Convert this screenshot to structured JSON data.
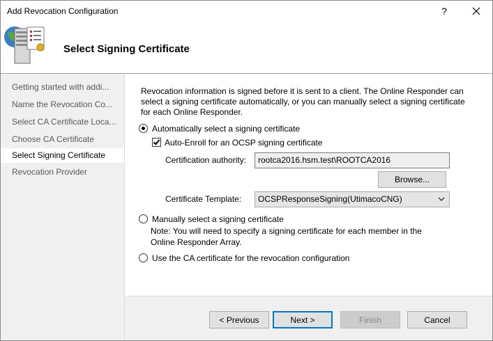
{
  "window": {
    "title": "Add Revocation Configuration",
    "help_label": "?",
    "close_label": "✕"
  },
  "header": {
    "title": "Select Signing Certificate",
    "icon": "certificate-server-icon"
  },
  "sidebar": {
    "items": [
      {
        "label": "Getting started with addi...",
        "active": false
      },
      {
        "label": "Name the Revocation Co...",
        "active": false
      },
      {
        "label": "Select CA Certificate Loca...",
        "active": false
      },
      {
        "label": "Choose CA Certificate",
        "active": false
      },
      {
        "label": "Select Signing Certificate",
        "active": true
      },
      {
        "label": "Revocation Provider",
        "active": false
      }
    ]
  },
  "main": {
    "description": "Revocation information is signed before it is sent to a client. The Online Responder can select a signing certificate automatically, or you can manually select a signing certificate for each Online Responder.",
    "option_auto": {
      "label": "Automatically select a signing certificate",
      "selected": true
    },
    "auto_enroll": {
      "label": "Auto-Enroll for an OCSP signing certificate",
      "checked": true
    },
    "ca_label": "Certification authority:",
    "ca_value": "rootca2016.hsm.test\\ROOTCA2016",
    "browse_label": "Browse...",
    "template_label": "Certificate Template:",
    "template_value": "OCSPResponseSigning(UtimacoCNG)",
    "option_manual": {
      "label": "Manually select a signing certificate",
      "selected": false
    },
    "manual_note": "Note: You will need to specify a signing certificate for each member in the Online Responder Array.",
    "option_ca_cert": {
      "label": "Use the CA certificate for the revocation configuration",
      "selected": false
    }
  },
  "footer": {
    "previous_label": "< Previous",
    "next_label": "Next >",
    "finish_label": "Finish",
    "cancel_label": "Cancel"
  },
  "colors": {
    "accent": "#0078d7",
    "sidebar_bg": "#f0f0f0"
  }
}
